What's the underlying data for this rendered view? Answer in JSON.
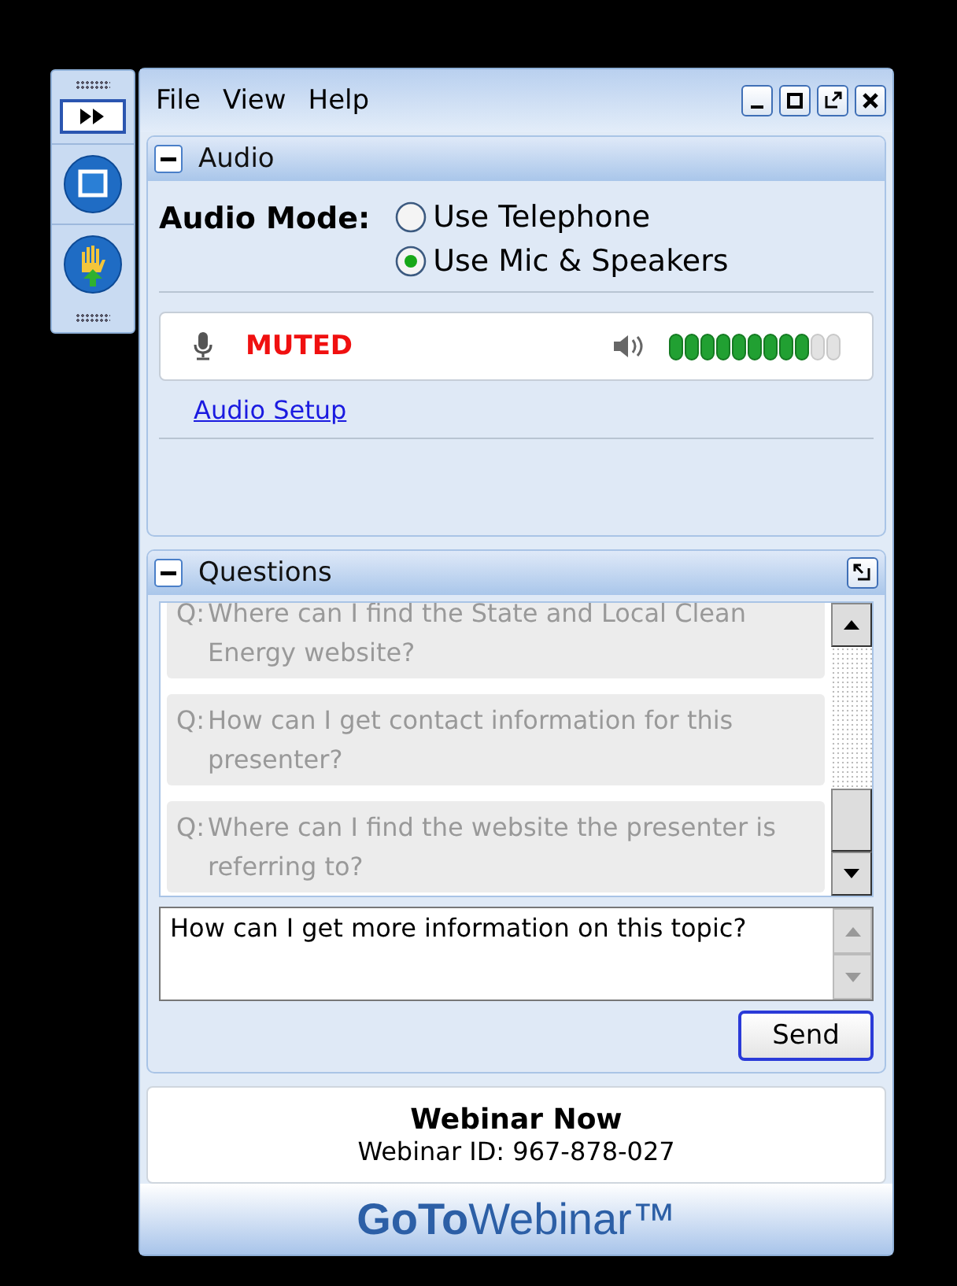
{
  "menu": [
    {
      "label": "File"
    },
    {
      "label": "View"
    },
    {
      "label": "Help"
    }
  ],
  "audio": {
    "title": "Audio",
    "expanded": true,
    "mode_label": "Audio Mode:",
    "options": [
      {
        "label": "Use Telephone",
        "selected": false
      },
      {
        "label": "Use Mic & Speakers",
        "selected": true
      }
    ],
    "mic_status": "MUTED",
    "speaker": {
      "level": 0.82
    },
    "setup_link": "Audio Setup"
  },
  "questions": {
    "title": "Questions",
    "expanded": true,
    "items": [
      {
        "prefix": "Q:",
        "text": "Where can I find the State and Local Clean Energy website?"
      },
      {
        "prefix": "Q:",
        "text": "How can I get contact information for this presenter?"
      },
      {
        "prefix": "Q:",
        "text": "Where can I find the website the presenter is referring to?"
      }
    ],
    "input": "How can I get more information on this topic?",
    "send": "Send"
  },
  "info": {
    "title": "Webinar Now",
    "webinar_id": "Webinar ID: 967-878-027"
  },
  "logo": "**GoTo**Webinar™"
}
